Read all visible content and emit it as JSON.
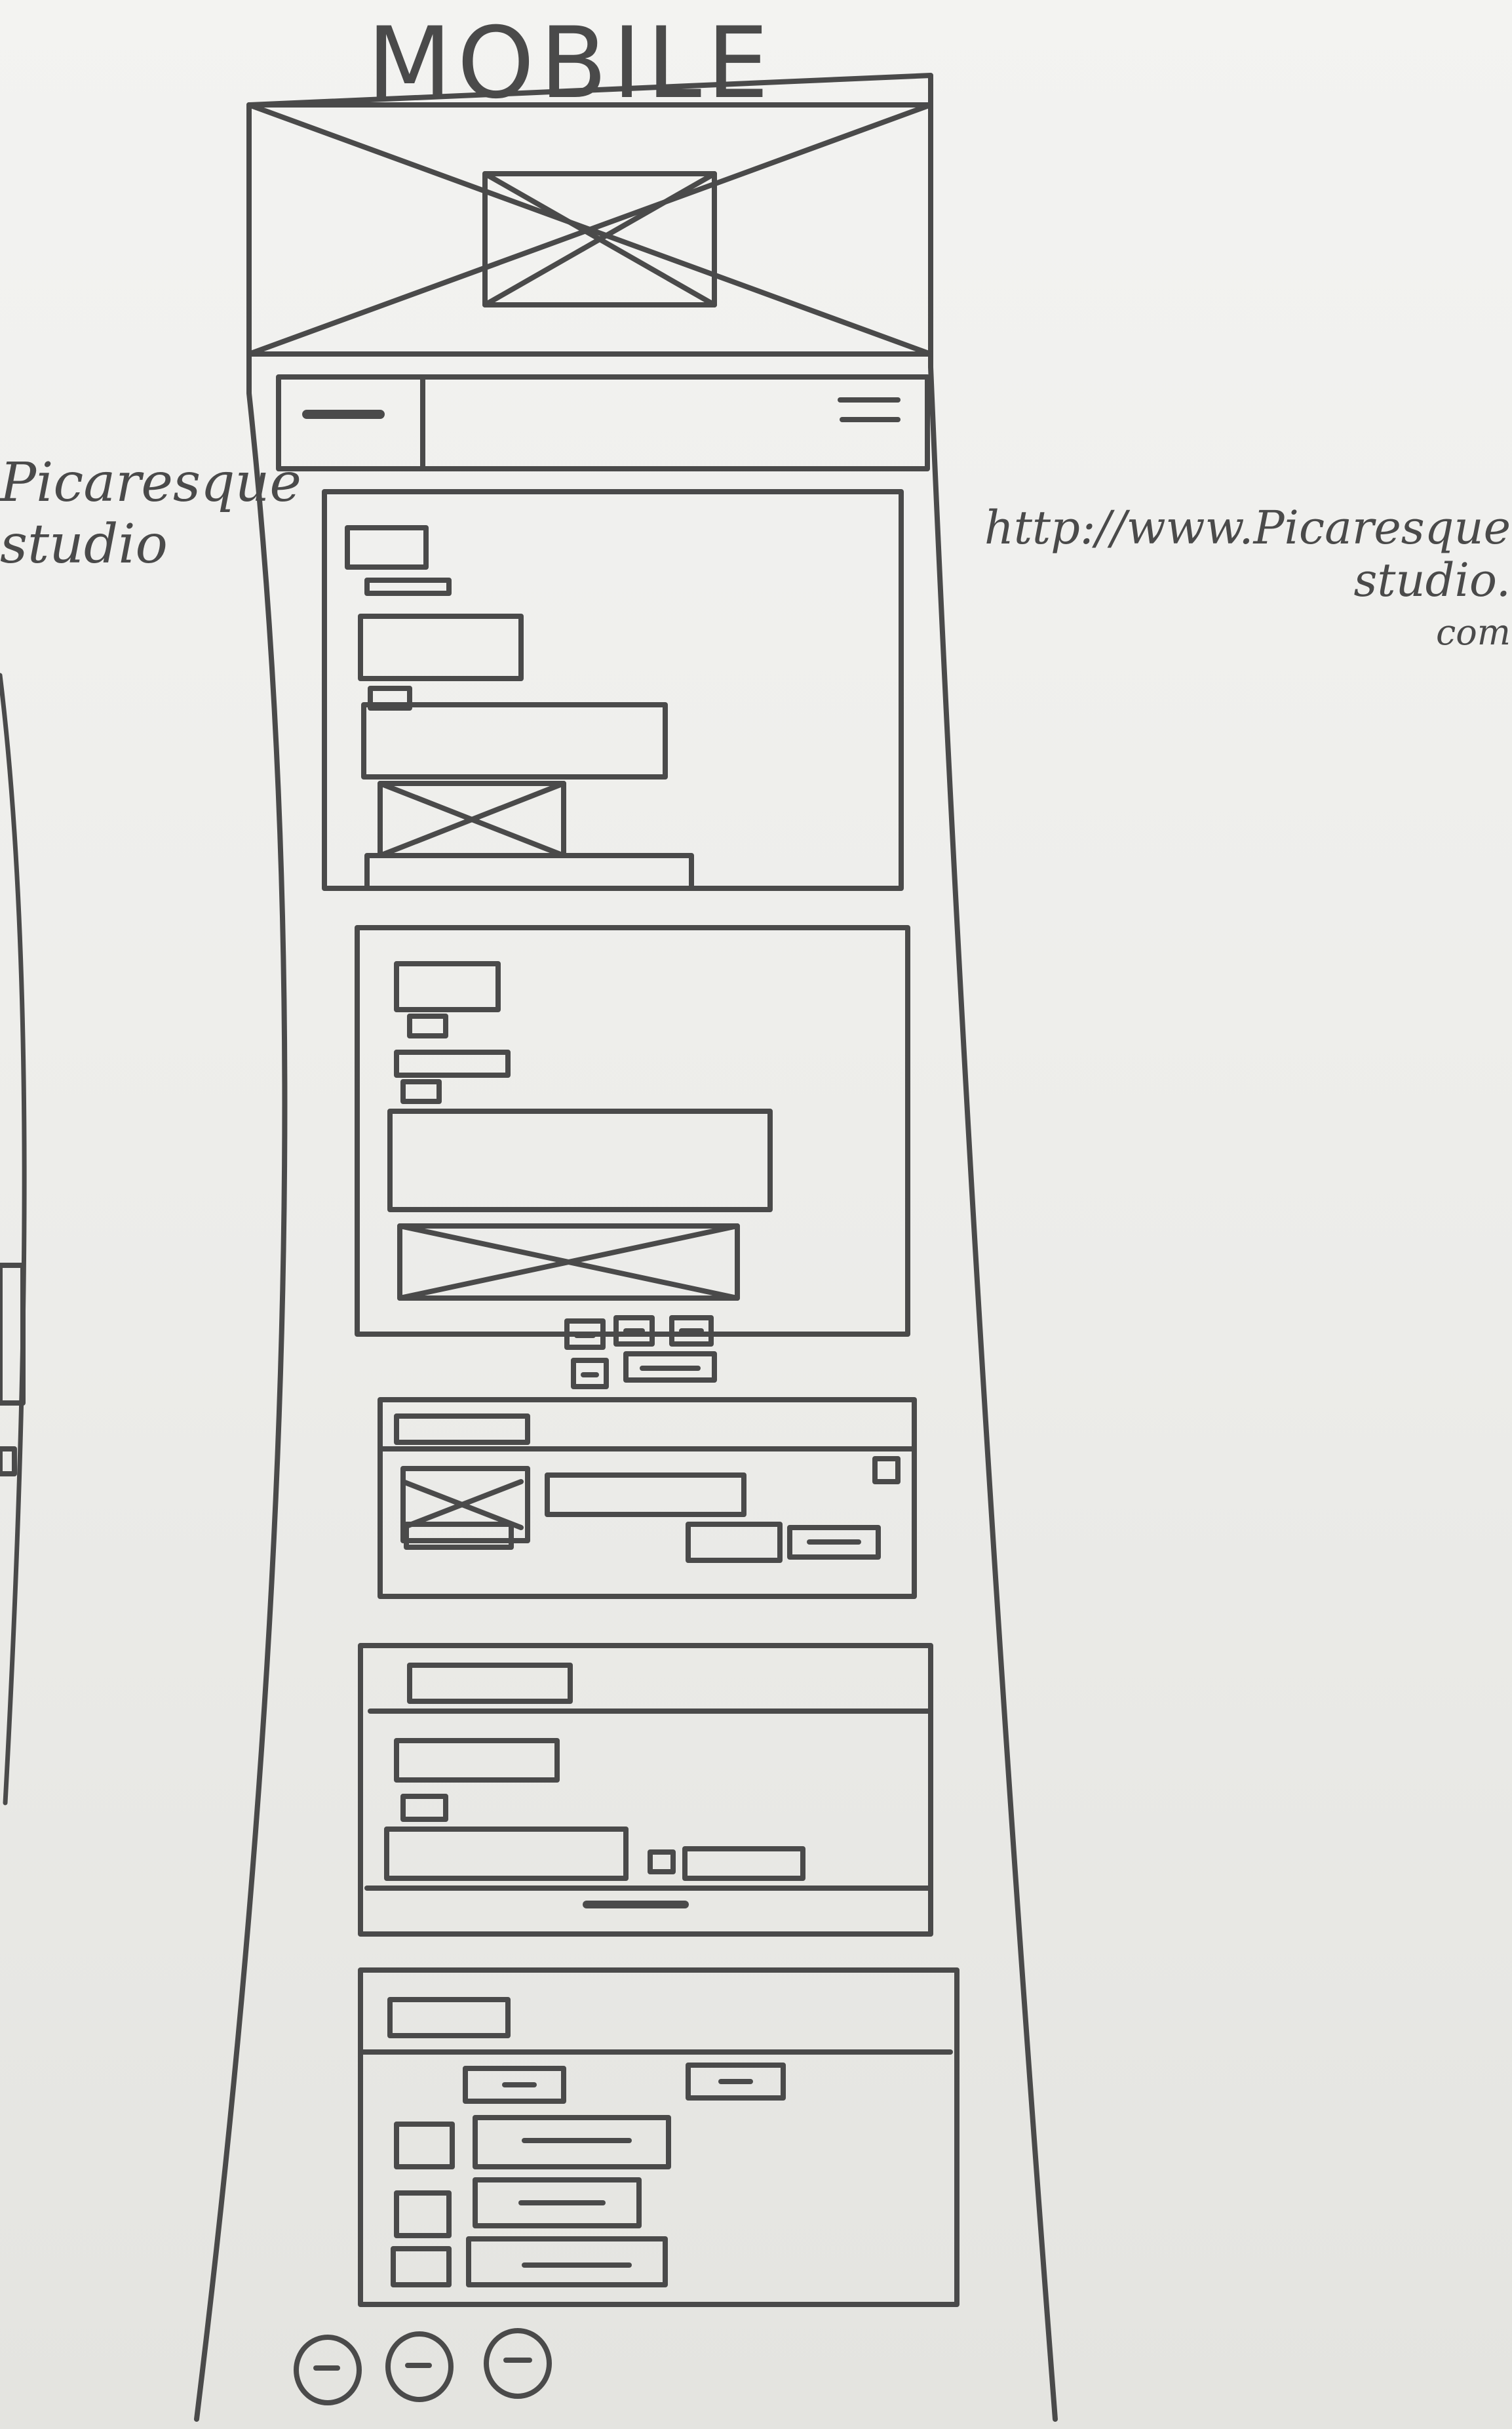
{
  "sketch": {
    "heading": "MOBILE",
    "site_name": "Picaresque studio",
    "url_line1": "http://www.Picaresque studio.",
    "url_line2": "com"
  },
  "colors": {
    "paper": "#efefed",
    "pencil": "#4a4a4a"
  }
}
